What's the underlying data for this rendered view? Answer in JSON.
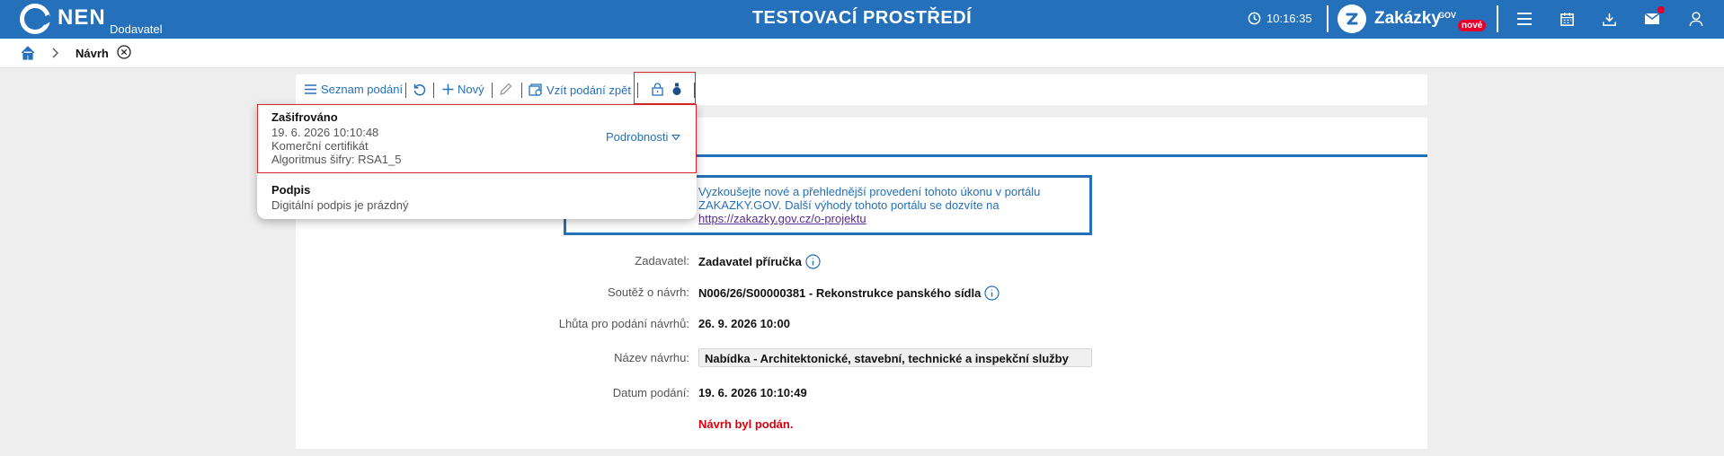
{
  "header": {
    "logo_text": "NEN",
    "logo_sub": "Dodavatel",
    "environment": "TESTOVACÍ PROSTŘEDÍ",
    "time": "10:16:35",
    "portal_name": "Zakázky",
    "portal_gov": "GOV",
    "portal_badge": "nové",
    "colors": {
      "bar": "#2470ba",
      "badge": "#e4002b"
    }
  },
  "breadcrumb": {
    "current": "Návrh"
  },
  "toolbar": {
    "list_label": "Seznam podání",
    "new_label": "Nový",
    "take_back_label": "Vzít podání zpět"
  },
  "dropdown": {
    "encryption": {
      "title": "Zašifrováno",
      "date": "19. 6. 2026 10:10:48",
      "certificate": "Komerční certifikát",
      "algorithm": "Algoritmus šifry: RSA1_5",
      "details_label": "Podrobnosti"
    },
    "signature": {
      "title": "Podpis",
      "status": "Digitální podpis je prázdný"
    }
  },
  "notice": {
    "text_line1": "Vyzkoušejte nové a přehlednější provedení tohoto úkonu v portálu",
    "text_line2": "ZAKAZKY.GOV. Další výhody tohoto portálu se dozvíte na",
    "link": "https://zakazky.gov.cz/o-projektu"
  },
  "form": {
    "contracting_label": "Zadavatel:",
    "contracting_value": "Zadavatel příručka",
    "competition_label": "Soutěž o návrh:",
    "competition_value": "N006/26/S00000381 - Rekonstrukce panského sídla",
    "deadline_label": "Lhůta pro podání návrhů:",
    "deadline_value": "26. 9. 2026 10:00",
    "name_label": "Název návrhu:",
    "name_value": "Nabídka - Architektonické, stavební, technické a inspekční služby",
    "date_label": "Datum podání:",
    "date_value": "19. 6. 2026 10:10:49",
    "status_text": "Návrh byl podán."
  }
}
